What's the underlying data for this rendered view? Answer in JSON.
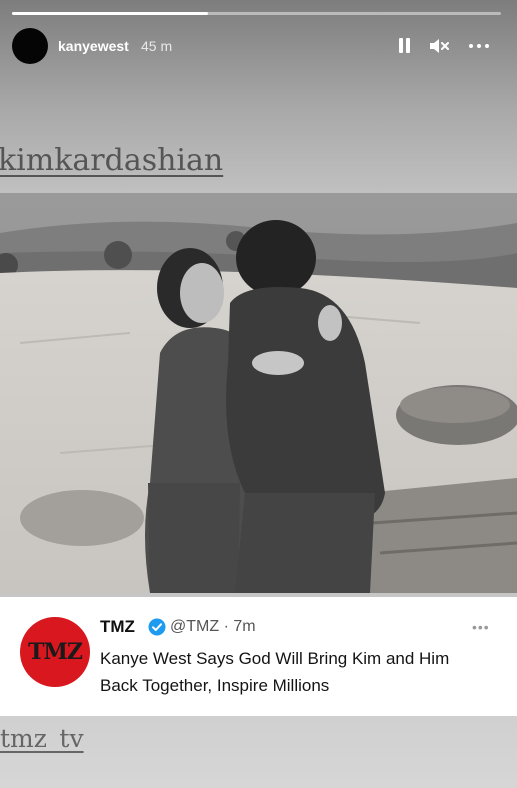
{
  "story": {
    "username": "kanyewest",
    "time_ago": "45 m",
    "progress": 0.4,
    "header_icons": [
      "pause-icon",
      "mute-icon",
      "more-icon"
    ]
  },
  "stickers": {
    "mention_top": "kimkardashian",
    "mention_bottom": "tmz_tv"
  },
  "photo": {
    "type": "black-and-white photograph",
    "colors": {
      "sky": "#9a9a9a",
      "rock": "#cfcbc6"
    }
  },
  "tweet": {
    "avatar_text": "TMZ",
    "name": "TMZ",
    "handle_time": "@TMZ · 7m",
    "text": "Kanye West Says God Will Bring Kim and Him Back Together, Inspire Millions",
    "colors": {
      "avatar_bg": "#d8171f",
      "verified": "#1d9bf0"
    }
  }
}
